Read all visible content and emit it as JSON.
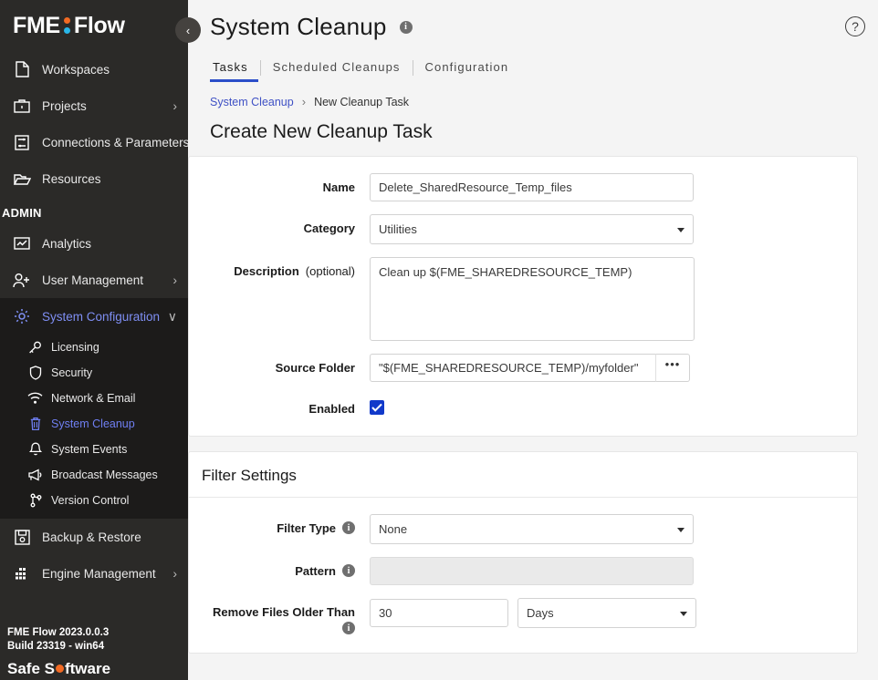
{
  "sidebar": {
    "logo": {
      "text_left": "FME",
      "text_right": "Flow",
      "dot_top_color": "#f26a23",
      "dot_bottom_color": "#29b6e8"
    },
    "collapse_toggle": "‹",
    "primary_items": [
      {
        "label": "Workspaces",
        "icon": "document-icon",
        "chevron": ""
      },
      {
        "label": "Projects",
        "icon": "briefcase-icon",
        "chevron": "›"
      },
      {
        "label": "Connections & Parameters",
        "icon": "connections-icon",
        "chevron": "›"
      },
      {
        "label": "Resources",
        "icon": "folder-icon",
        "chevron": ""
      }
    ],
    "admin_label": "ADMIN",
    "admin_items": [
      {
        "label": "Analytics",
        "icon": "analytics-icon",
        "chevron": ""
      },
      {
        "label": "User Management",
        "icon": "user-add-icon",
        "chevron": "›"
      }
    ],
    "system_configuration": {
      "label": "System Configuration",
      "icon": "gear-icon",
      "chevron": "∨"
    },
    "system_configuration_children": [
      {
        "label": "Licensing",
        "icon": "key-icon",
        "active": false
      },
      {
        "label": "Security",
        "icon": "shield-icon",
        "active": false
      },
      {
        "label": "Network & Email",
        "icon": "wifi-icon",
        "active": false
      },
      {
        "label": "System Cleanup",
        "icon": "trash-icon",
        "active": true
      },
      {
        "label": "System Events",
        "icon": "bell-icon",
        "active": false
      },
      {
        "label": "Broadcast Messages",
        "icon": "megaphone-icon",
        "active": false
      },
      {
        "label": "Version Control",
        "icon": "branch-icon",
        "active": false
      }
    ],
    "bottom_items": [
      {
        "label": "Backup & Restore",
        "icon": "save-disk-icon",
        "chevron": ""
      },
      {
        "label": "Engine Management",
        "icon": "engine-grid-icon",
        "chevron": "›"
      }
    ],
    "footer": {
      "version": "FME Flow 2023.0.0.3",
      "build": "Build 23319 - win64",
      "company_part1": "Safe S",
      "company_part2": "ftware"
    }
  },
  "header": {
    "title": "System Cleanup",
    "title_info_glyph": "i",
    "help_glyph": "?",
    "tabs": [
      {
        "label": "Tasks",
        "active": true
      },
      {
        "label": "Scheduled Cleanups",
        "active": false
      },
      {
        "label": "Configuration",
        "active": false
      }
    ],
    "breadcrumb": {
      "root": "System Cleanup",
      "separator": "›",
      "current": "New Cleanup Task"
    }
  },
  "page": {
    "section_title": "Create New Cleanup Task",
    "main_form": {
      "name": {
        "label": "Name",
        "value": "Delete_SharedResource_Temp_files"
      },
      "category": {
        "label": "Category",
        "value": "Utilities"
      },
      "description": {
        "label": "Description",
        "label_optional": "(optional)",
        "value": "Clean up $(FME_SHAREDRESOURCE_TEMP)"
      },
      "source_folder": {
        "label": "Source Folder",
        "value": "\"$(FME_SHAREDRESOURCE_TEMP)/myfolder\"",
        "browse_label": "•••"
      },
      "enabled": {
        "label": "Enabled",
        "checked": true
      }
    },
    "filter_settings": {
      "card_title": "Filter Settings",
      "filter_type": {
        "label": "Filter Type",
        "value": "None",
        "info_glyph": "i"
      },
      "pattern": {
        "label": "Pattern",
        "value": "",
        "info_glyph": "i",
        "disabled": true
      },
      "remove_older_than": {
        "label": "Remove Files Older Than",
        "count": "30",
        "units": "Days",
        "info_glyph": "i"
      }
    }
  },
  "colors": {
    "sidebar_bg": "#2b2a28",
    "sidebar_sub_bg": "#1c1b1a",
    "accent_blue": "#2b4ec9",
    "link_blue": "#3f51c5",
    "active_nav": "#6f7ff2",
    "checkbox_blue": "#1139ca",
    "brand_orange": "#f26a23",
    "brand_cyan": "#29b6e8"
  }
}
